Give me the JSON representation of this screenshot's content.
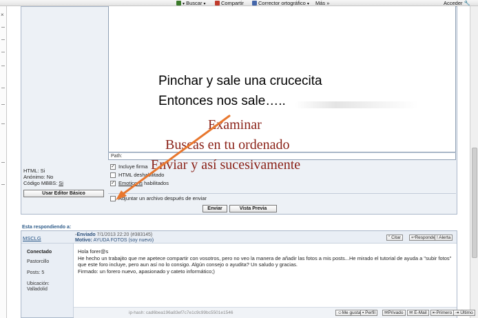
{
  "toolbar": {
    "buscar": "Buscar",
    "compartir": "Compartir",
    "corrector": "Corrector ortográfico",
    "mas": "Más",
    "acceder": "Acceder"
  },
  "editor": {
    "path_label": "Path:",
    "options": [
      {
        "label": "Incluye firma",
        "checked": true
      },
      {
        "label": "HTML deshabilitado",
        "checked": false
      },
      {
        "label_link": "Emoticons",
        "label_rest": " habilitados",
        "checked": true
      },
      {
        "label": "Adjuntar un archivo después de enviar",
        "checked": false
      }
    ],
    "info": {
      "html": "HTML: Si",
      "anonimo": "Anónimo: No",
      "codigo_prefix": "Código MBBS: ",
      "codigo_link": "Si"
    },
    "basic_editor_button": "Usar Editor Básico",
    "send_button": "Enviar",
    "preview_button": "Vista Previa"
  },
  "annotations": {
    "line1": "Pinchar y sale una crucecita",
    "line2": "Entonces nos sale…..",
    "step1": "Examinar",
    "step2": "Buscas en tu ordenado",
    "step3": "Enviar y así sucesivamente",
    "arrow_color": "#e8772e",
    "red_color": "#8a2218"
  },
  "reply": {
    "header": "Esta respondiendo a:",
    "username": "MSCLG",
    "sent_label": "Enviado",
    "sent_date": "7/1/2013 22:20 (#383145)",
    "motivo_label": "Motivo:",
    "motivo": "AYUDA FOTOS (soy nuevo)",
    "status": "Conectado",
    "rank": "Pastorcillo",
    "posts": "Posts: 5",
    "location_label": "Ubicación:",
    "location": "Valladolid",
    "greeting": "Hola forer@s",
    "message": "He hecho un trabajito que me apetece compartir con vosotros, pero no veo la manera de añadir las fotos a mis posts...He mirado el tutorial de ayuda a \"subir fotos\" que este foro incluye, pero aun así no lo consigo. Algún consejo o ayudita? Un saludo y gracias.",
    "signature": "Firmado: un forero nuevo, apasionado y cateto informático;)",
    "ip_hash": "ip-hash: cad6bea196a83ef7c7e1c9c99bc5501e1546",
    "top_buttons": [
      "Citar",
      "Responder",
      "Alerta"
    ],
    "bottom_buttons": [
      "Me gusta",
      "Perfil",
      "Privado",
      "E-Mail",
      "Primero",
      "Último"
    ]
  }
}
